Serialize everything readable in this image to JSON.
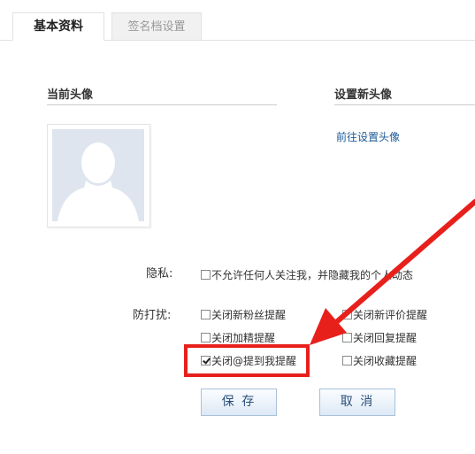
{
  "tabs": [
    {
      "label": "基本资料",
      "active": true
    },
    {
      "label": "签名档设置",
      "active": false
    }
  ],
  "avatar_section": {
    "current_title": "当前头像",
    "new_title": "设置新头像",
    "goto_link": "前往设置头像"
  },
  "privacy": {
    "label": "隐私:",
    "option": {
      "text": "不允许任何人关注我，并隐藏我的个人动态",
      "checked": false
    }
  },
  "dnd": {
    "label": "防打扰:",
    "options": [
      {
        "text": "关闭新粉丝提醒",
        "checked": false
      },
      {
        "text": "关闭新评价提醒",
        "checked": false
      },
      {
        "text": "关闭加精提醒",
        "checked": false
      },
      {
        "text": "关闭回复提醒",
        "checked": false
      },
      {
        "text": "关闭@提到我提醒",
        "checked": true
      },
      {
        "text": "关闭收藏提醒",
        "checked": false
      }
    ]
  },
  "buttons": {
    "save": "保 存",
    "cancel": "取 消"
  },
  "colors": {
    "annotation": "#e8201c",
    "link": "#1a5a96"
  }
}
